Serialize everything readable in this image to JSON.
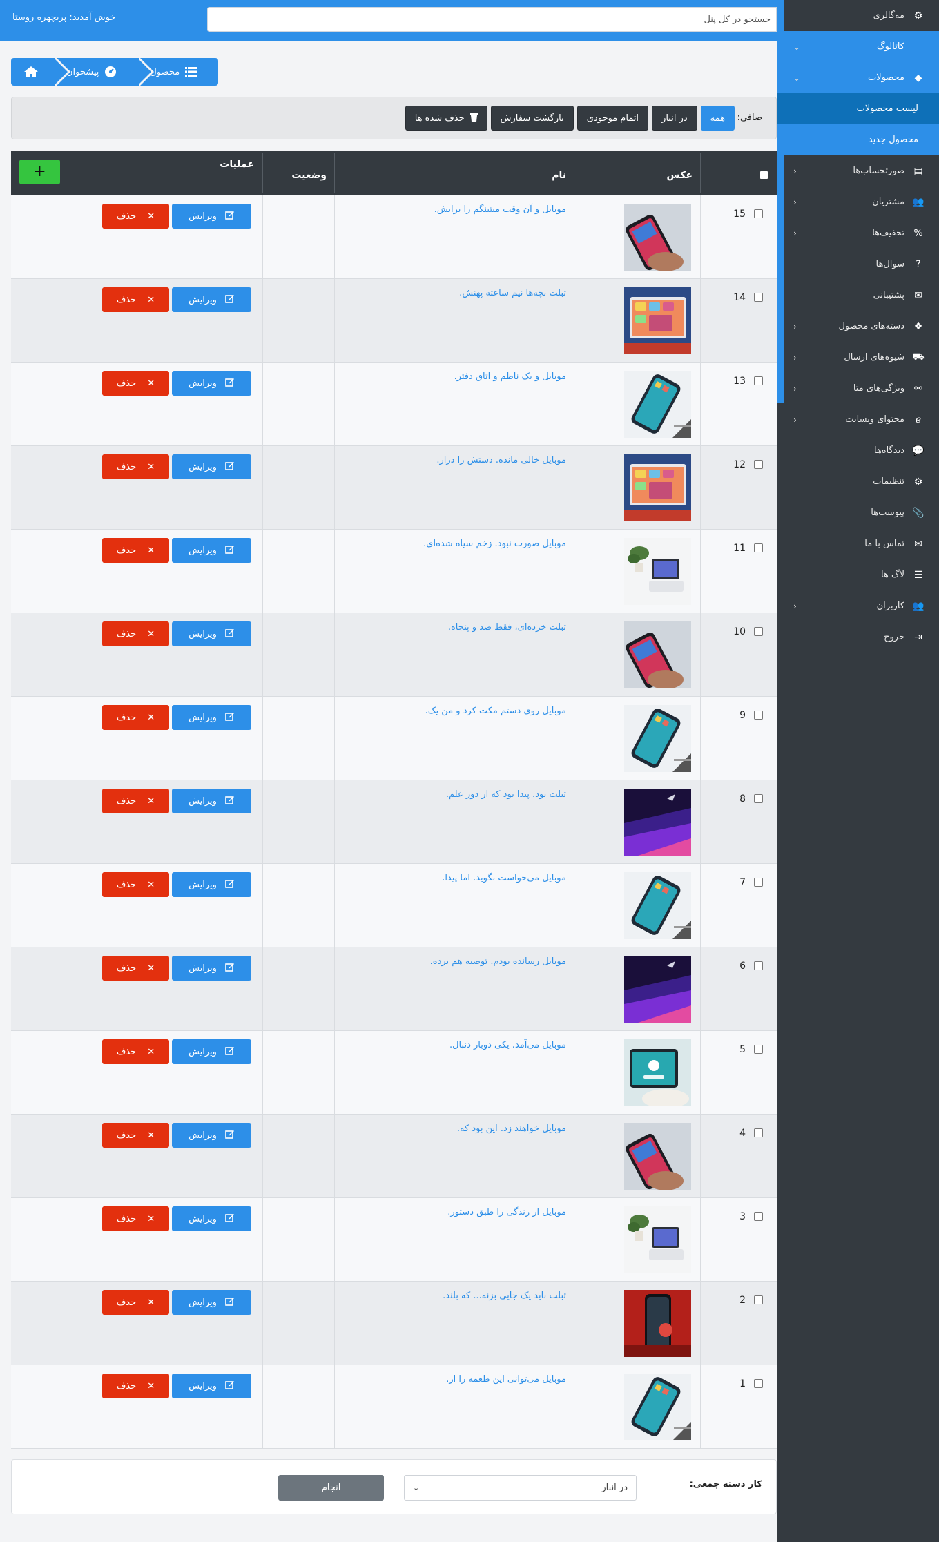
{
  "topbar": {
    "search_placeholder": "جستجو در کل پنل",
    "welcome": "خوش آمدید: پریچهره روستا"
  },
  "sidebar": {
    "items": [
      {
        "label": "مه‌گالری",
        "icon": "gear-icon",
        "glyph": "⚙",
        "chevron": ""
      },
      {
        "label": "کاتالوگ",
        "icon": "apple-icon",
        "glyph": "",
        "chevron": "⌄"
      },
      {
        "label": "محصولات",
        "icon": "diamond-icon",
        "glyph": "◆",
        "chevron": "⌄"
      },
      {
        "label": "لیست محصولات",
        "icon": "",
        "glyph": "",
        "chevron": ""
      },
      {
        "label": "محصول جدید",
        "icon": "",
        "glyph": "",
        "chevron": ""
      },
      {
        "label": "صورتحساب‌ها",
        "icon": "invoice-icon",
        "glyph": "▤",
        "chevron": "‹"
      },
      {
        "label": "مشتریان",
        "icon": "users-icon",
        "glyph": "👥",
        "chevron": "‹"
      },
      {
        "label": "تخفیف‌ها",
        "icon": "percent-icon",
        "glyph": "%",
        "chevron": "‹"
      },
      {
        "label": "سوال‌ها",
        "icon": "question-icon",
        "glyph": "?",
        "chevron": ""
      },
      {
        "label": "پشتیبانی",
        "icon": "envelope-icon",
        "glyph": "✉",
        "chevron": ""
      },
      {
        "label": "دسته‌های محصول",
        "icon": "cubes-icon",
        "glyph": "❖",
        "chevron": "‹"
      },
      {
        "label": "شیوه‌های ارسال",
        "icon": "truck-icon",
        "glyph": "⛟",
        "chevron": "‹"
      },
      {
        "label": "ویژگی‌های متا",
        "icon": "share-nodes-icon",
        "glyph": "⚯",
        "chevron": "‹"
      },
      {
        "label": "محتوای وبسایت",
        "icon": "edge-icon",
        "glyph": "ℯ",
        "chevron": "‹"
      },
      {
        "label": "دیدگاه‌ها",
        "icon": "comments-icon",
        "glyph": "💬",
        "chevron": ""
      },
      {
        "label": "تنظیمات",
        "icon": "cogs-icon",
        "glyph": "⚙",
        "chevron": ""
      },
      {
        "label": "پیوست‌ها",
        "icon": "paperclip-icon",
        "glyph": "📎",
        "chevron": ""
      },
      {
        "label": "تماس با ما",
        "icon": "envelope-icon",
        "glyph": "✉",
        "chevron": ""
      },
      {
        "label": "لاگ ها",
        "icon": "list-icon",
        "glyph": "☰",
        "chevron": ""
      },
      {
        "label": "کاربران",
        "icon": "users-cog-icon",
        "glyph": "👥",
        "chevron": "‹"
      },
      {
        "label": "خروج",
        "icon": "sign-out-icon",
        "glyph": "⇥",
        "chevron": ""
      }
    ]
  },
  "breadcrumb": {
    "home_icon": "home-icon",
    "dashboard": "پیشخوان",
    "product": "محصول"
  },
  "filter": {
    "label": "صافی:",
    "buttons": [
      "همه",
      "در انبار",
      "اتمام موجودی",
      "بازگشت سفارش",
      "حذف شده ها"
    ],
    "active": "همه"
  },
  "table": {
    "headers": {
      "photo": "عکس",
      "name": "نام",
      "status": "وضعیت",
      "actions": "عملیات"
    },
    "add_label": "+",
    "edit_label": "ویرایش",
    "delete_label": "حذف",
    "rows": [
      {
        "id": "15",
        "name": "موبایل و آن وقت میتینگم را برایش.",
        "img": "phone-red"
      },
      {
        "id": "14",
        "name": "تبلت بچه‌ها نیم ساعته پهنش.",
        "img": "tablet-blue"
      },
      {
        "id": "13",
        "name": "موبایل و یک ناظم و اتاق دفتر.",
        "img": "phone-white"
      },
      {
        "id": "12",
        "name": "موبایل خالی مانده. دستش را دراز.",
        "img": "tablet-blue"
      },
      {
        "id": "11",
        "name": "موبایل صورت نبود. زخم سیاه شده‌ای.",
        "img": "desk-plant"
      },
      {
        "id": "10",
        "name": "تبلت خرده‌ای، فقط صد و پنجاه.",
        "img": "phone-red"
      },
      {
        "id": "9",
        "name": "موبایل روی دستم مکث کرد و من یک.",
        "img": "phone-white"
      },
      {
        "id": "8",
        "name": "تبلت بود. پیدا بود که از دور علم.",
        "img": "laptop-purple"
      },
      {
        "id": "7",
        "name": "موبایل می‌خواست بگوید. اما پیدا.",
        "img": "phone-white"
      },
      {
        "id": "6",
        "name": "موبایل رسانده بودم. توصیه هم برده.",
        "img": "laptop-purple"
      },
      {
        "id": "5",
        "name": "موبایل می‌آمد. یکی دوبار دنبال.",
        "img": "tablet-hand"
      },
      {
        "id": "4",
        "name": "موبایل خواهند زد. این بود که.",
        "img": "phone-red"
      },
      {
        "id": "3",
        "name": "موبایل از زندگی را طبق دستور.",
        "img": "desk-plant"
      },
      {
        "id": "2",
        "name": "تبلت باید یک جایی بزنه... که بلند.",
        "img": "phone-dark-red"
      },
      {
        "id": "1",
        "name": "موبایل می‌توانی این طعمه را از.",
        "img": "phone-white"
      }
    ]
  },
  "bulk": {
    "label": "کار دسته جمعی:",
    "selected": "در انبار",
    "submit": "انجام"
  }
}
